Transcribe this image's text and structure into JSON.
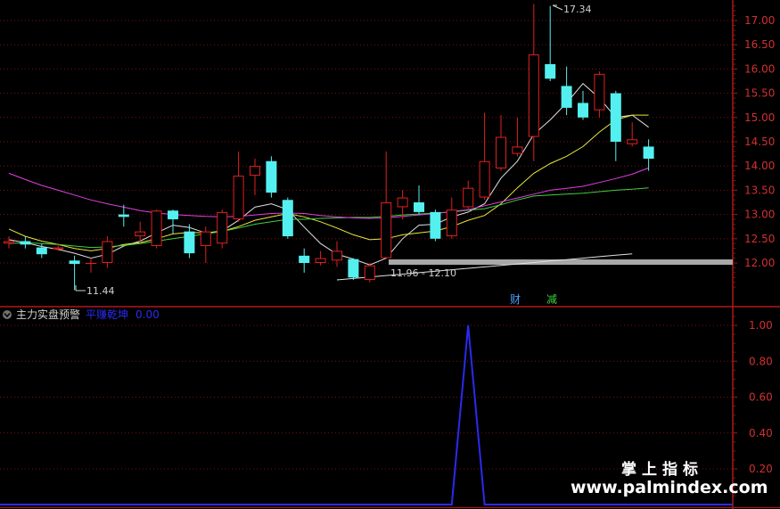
{
  "chart_data": [
    {
      "type": "candlestick",
      "ylim": [
        11.45,
        17.45
      ],
      "y_ticks": [
        "17.00",
        "16.50",
        "16.00",
        "15.50",
        "15.00",
        "14.50",
        "14.00",
        "13.50",
        "13.00",
        "12.50",
        "12.00"
      ],
      "candles": [
        {
          "o": 12.4,
          "c": 12.45,
          "h": 12.55,
          "l": 12.3
        },
        {
          "o": 12.45,
          "c": 12.38,
          "h": 12.55,
          "l": 12.3
        },
        {
          "o": 12.32,
          "c": 12.18,
          "h": 12.4,
          "l": 12.1
        },
        {
          "o": 12.28,
          "c": 12.32,
          "h": 12.4,
          "l": 12.25
        },
        {
          "o": 12.05,
          "c": 11.98,
          "h": 12.15,
          "l": 11.44
        },
        {
          "o": 11.98,
          "c": 12.0,
          "h": 12.1,
          "l": 11.8
        },
        {
          "o": 12.0,
          "c": 12.45,
          "h": 12.55,
          "l": 11.9
        },
        {
          "o": 13.0,
          "c": 12.95,
          "h": 13.2,
          "l": 12.75
        },
        {
          "o": 12.55,
          "c": 12.65,
          "h": 12.85,
          "l": 12.4
        },
        {
          "o": 12.35,
          "c": 13.08,
          "h": 13.1,
          "l": 12.3
        },
        {
          "o": 13.08,
          "c": 12.9,
          "h": 13.1,
          "l": 12.6
        },
        {
          "o": 12.65,
          "c": 12.2,
          "h": 12.8,
          "l": 12.1
        },
        {
          "o": 12.35,
          "c": 12.65,
          "h": 12.75,
          "l": 12.0
        },
        {
          "o": 12.4,
          "c": 13.05,
          "h": 13.1,
          "l": 12.3
        },
        {
          "o": 12.9,
          "c": 13.8,
          "h": 14.3,
          "l": 12.85
        },
        {
          "o": 13.8,
          "c": 14.0,
          "h": 14.15,
          "l": 13.4
        },
        {
          "o": 14.1,
          "c": 13.45,
          "h": 14.2,
          "l": 13.35
        },
        {
          "o": 13.3,
          "c": 12.55,
          "h": 13.35,
          "l": 12.5
        },
        {
          "o": 12.15,
          "c": 12.0,
          "h": 12.3,
          "l": 11.8
        },
        {
          "o": 12.0,
          "c": 12.1,
          "h": 12.25,
          "l": 11.95
        },
        {
          "o": 12.05,
          "c": 12.25,
          "h": 12.45,
          "l": 11.92
        },
        {
          "o": 12.08,
          "c": 11.7,
          "h": 12.1,
          "l": 11.65
        },
        {
          "o": 11.65,
          "c": 11.95,
          "h": 12.0,
          "l": 11.6
        },
        {
          "o": 12.1,
          "c": 13.25,
          "h": 14.3,
          "l": 12.1
        },
        {
          "o": 13.15,
          "c": 13.35,
          "h": 13.5,
          "l": 12.9
        },
        {
          "o": 13.25,
          "c": 13.05,
          "h": 13.6,
          "l": 13.0
        },
        {
          "o": 13.05,
          "c": 12.5,
          "h": 13.1,
          "l": 12.45
        },
        {
          "o": 12.55,
          "c": 13.1,
          "h": 13.35,
          "l": 12.5
        },
        {
          "o": 13.15,
          "c": 13.55,
          "h": 13.7,
          "l": 13.1
        },
        {
          "o": 13.35,
          "c": 14.1,
          "h": 15.1,
          "l": 13.3
        },
        {
          "o": 13.95,
          "c": 14.6,
          "h": 15.05,
          "l": 13.9
        },
        {
          "o": 14.25,
          "c": 14.4,
          "h": 15.0,
          "l": 14.2
        },
        {
          "o": 14.6,
          "c": 16.3,
          "h": 17.34,
          "l": 14.1
        },
        {
          "o": 16.1,
          "c": 15.8,
          "h": 17.3,
          "l": 15.75
        },
        {
          "o": 15.65,
          "c": 15.2,
          "h": 16.05,
          "l": 15.05
        },
        {
          "o": 15.3,
          "c": 15.0,
          "h": 15.55,
          "l": 14.95
        },
        {
          "o": 15.15,
          "c": 15.9,
          "h": 15.95,
          "l": 15.0
        },
        {
          "o": 15.5,
          "c": 14.5,
          "h": 15.55,
          "l": 14.1
        },
        {
          "o": 14.45,
          "c": 14.55,
          "h": 14.9,
          "l": 14.4
        },
        {
          "o": 14.4,
          "c": 14.15,
          "h": 14.55,
          "l": 13.9
        }
      ],
      "moving_averages": [
        {
          "color": "#e0e0e0",
          "values": [
            12.48,
            12.42,
            12.34,
            12.28,
            12.2,
            12.1,
            12.18,
            12.35,
            12.45,
            12.62,
            12.78,
            12.73,
            12.62,
            12.66,
            12.88,
            13.15,
            13.22,
            13.1,
            12.74,
            12.4,
            12.18,
            12.08,
            11.96,
            12.1,
            12.5,
            12.78,
            12.8,
            12.95,
            13.05,
            13.22,
            13.75,
            14.1,
            14.65,
            14.95,
            15.3,
            15.7,
            15.4,
            15.0,
            15.05,
            14.8
          ]
        },
        {
          "color": "#e8e840",
          "values": [
            12.7,
            12.55,
            12.45,
            12.38,
            12.3,
            12.25,
            12.3,
            12.38,
            12.42,
            12.5,
            12.6,
            12.63,
            12.62,
            12.65,
            12.75,
            12.88,
            12.95,
            13.02,
            12.95,
            12.85,
            12.72,
            12.58,
            12.48,
            12.5,
            12.58,
            12.62,
            12.66,
            12.75,
            12.88,
            12.98,
            13.22,
            13.55,
            13.85,
            14.05,
            14.2,
            14.4,
            14.7,
            14.95,
            15.05,
            15.05
          ]
        },
        {
          "color": "#40d040",
          "values": [
            12.4,
            12.42,
            12.4,
            12.38,
            12.35,
            12.32,
            12.33,
            12.36,
            12.4,
            12.45,
            12.5,
            12.55,
            12.6,
            12.65,
            12.72,
            12.8,
            12.85,
            12.9,
            12.9,
            12.92,
            12.93,
            12.94,
            12.94,
            12.96,
            12.99,
            13.01,
            13.03,
            13.05,
            13.09,
            13.12,
            13.2,
            13.3,
            13.38,
            13.4,
            13.42,
            13.44,
            13.47,
            13.5,
            13.52,
            13.55
          ]
        },
        {
          "color": "#e040e0",
          "values": [
            13.85,
            13.72,
            13.6,
            13.5,
            13.4,
            13.3,
            13.22,
            13.15,
            13.08,
            13.03,
            13.0,
            12.98,
            12.96,
            12.95,
            12.96,
            12.99,
            13.02,
            13.03,
            13.02,
            12.98,
            12.95,
            12.93,
            12.92,
            12.93,
            12.96,
            12.99,
            13.02,
            13.06,
            13.1,
            13.18,
            13.26,
            13.34,
            13.42,
            13.5,
            13.54,
            13.58,
            13.66,
            13.74,
            13.83,
            13.96
          ]
        },
        {
          "color": "#e0e0e0",
          "start": 20,
          "values": [
            11.65,
            11.68,
            11.71,
            11.74,
            11.77,
            11.8,
            11.83,
            11.86,
            11.89,
            11.92,
            11.95,
            11.98,
            12.01,
            12.04,
            12.07,
            12.1,
            12.13,
            12.16,
            12.19
          ]
        }
      ],
      "annotations": {
        "high_label": "17.34",
        "low_label": "11.44",
        "range_label": "11.96 - 12.10"
      },
      "markers": [
        {
          "text": "财",
          "color": "#4aa0ff"
        },
        {
          "text": "减",
          "color": "#40d040"
        }
      ]
    },
    {
      "type": "line",
      "title": "主力实盘预警",
      "series": [
        {
          "name": "平赚乾坤",
          "color": "#2a2af0",
          "values": [
            0,
            0,
            0,
            0,
            0,
            0,
            0,
            0,
            0,
            0,
            0,
            0,
            0,
            0,
            0,
            0,
            0,
            0,
            0,
            0,
            0,
            0,
            0,
            0,
            0,
            0,
            0,
            0,
            1.0,
            0,
            0,
            0,
            0,
            0,
            0,
            0,
            0,
            0,
            0,
            0
          ]
        }
      ],
      "current_value": "0.00",
      "ylim": [
        0,
        1.1
      ],
      "y_ticks": [
        "1.00",
        "0.80",
        "0.60",
        "0.40",
        "0.20"
      ]
    }
  ],
  "watermark": {
    "cn": "掌上指标",
    "url": "www.palmindex.com"
  }
}
